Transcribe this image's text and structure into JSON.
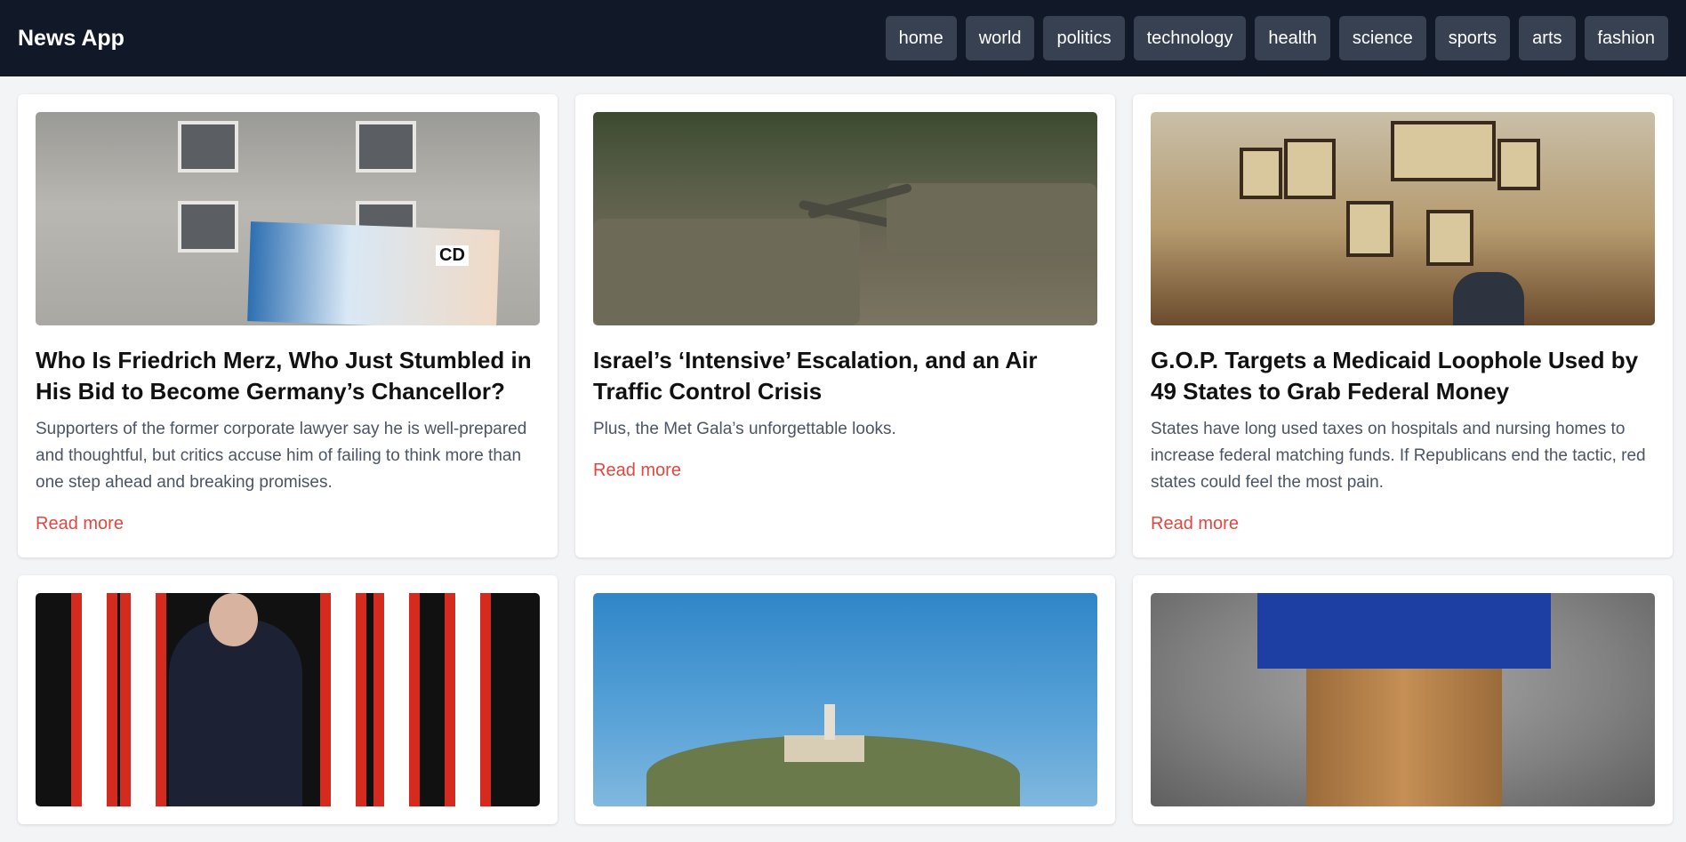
{
  "header": {
    "brand": "News App",
    "nav": [
      "home",
      "world",
      "politics",
      "technology",
      "health",
      "science",
      "sports",
      "arts",
      "fashion"
    ]
  },
  "articles": [
    {
      "title": "Who Is Friedrich Merz, Who Just Stumbled in His Bid to Become Germany’s Chancellor?",
      "description": "Supporters of the former corporate lawyer say he is well-prepared and thoughtful, but critics accuse him of failing to think more than one step ahead and breaking promises.",
      "link_label": "Read more",
      "image_text": "CD"
    },
    {
      "title": "Israel’s ‘Intensive’ Escalation, and an Air Traffic Control Crisis",
      "description": "Plus, the Met Gala’s unforgettable looks.",
      "link_label": "Read more"
    },
    {
      "title": "G.O.P. Targets a Medicaid Loophole Used by 49 States to Grab Federal Money",
      "description": "States have long used taxes on hospitals and nursing homes to increase federal matching funds. If Republicans end the tactic, red states could feel the most pain.",
      "link_label": "Read more"
    }
  ],
  "colors": {
    "header_bg": "#111827",
    "nav_button_bg": "#374151",
    "page_bg": "#f3f4f6",
    "link": "#e0473f"
  }
}
